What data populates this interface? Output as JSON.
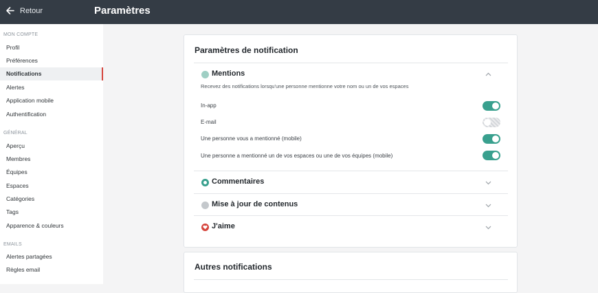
{
  "header": {
    "back_label": "Retour",
    "title": "Paramètres"
  },
  "sidebar": {
    "sections": [
      {
        "heading": "MON COMPTE",
        "items": [
          "Profil",
          "Préférences",
          "Notifications",
          "Alertes",
          "Application mobile",
          "Authentification"
        ]
      },
      {
        "heading": "GÉNÉRAL",
        "items": [
          "Aperçu",
          "Membres",
          "Équipes",
          "Espaces",
          "Catégories",
          "Tags",
          "Apparence & couleurs"
        ]
      },
      {
        "heading": "EMAILS",
        "items": [
          "Alertes partagées",
          "Règles email"
        ]
      }
    ],
    "active_item": "Notifications",
    "active_color": "#d6453d"
  },
  "notifications": {
    "title": "Paramètres de notification",
    "mentions": {
      "title": "Mentions",
      "description": "Recevez des notifications lorsqu'une personne mentionne votre nom ou un de vos espaces",
      "options": [
        {
          "label": "In-app",
          "enabled": true
        },
        {
          "label": "E-mail",
          "enabled": false
        },
        {
          "label": "Une personne vous a mentionné (mobile)",
          "enabled": true
        },
        {
          "label": "Une personne a mentionné un de vos espaces ou une de vos équipes (mobile)",
          "enabled": true
        }
      ]
    },
    "sections": [
      {
        "title": "Commentaires",
        "icon": "comment-icon",
        "color": "#39a08e"
      },
      {
        "title": "Mise à jour de contenus",
        "icon": "update-icon",
        "color": "#c4c8cc"
      },
      {
        "title": "J'aime",
        "icon": "heart-icon",
        "color": "#d6453d"
      }
    ]
  },
  "other": {
    "title": "Autres notifications"
  },
  "colors": {
    "toggle_on": "#39a08e",
    "header_bg": "#343c45"
  }
}
